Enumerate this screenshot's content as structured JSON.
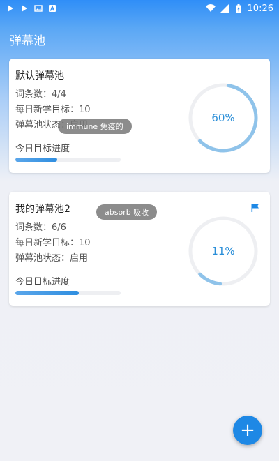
{
  "statusbar": {
    "time": "10:26",
    "left_icons": [
      "youku-icon",
      "youku-icon",
      "image-icon",
      "a-icon"
    ],
    "right_icons": [
      "wifi-icon",
      "signal-icon",
      "battery-icon"
    ]
  },
  "app": {
    "title": "弹幕池"
  },
  "cards": [
    {
      "title": "默认弹幕池",
      "word_count": "词条数：4/4",
      "daily_goal": "每日新学目标：10",
      "status": "弹幕池状态：启用",
      "progress_label": "今日目标进度",
      "progress_fraction": 0.4,
      "ring_percent": 60,
      "ring_label": "60%",
      "flagged": false
    },
    {
      "title": "我的弹幕池2",
      "word_count": "词条数：6/6",
      "daily_goal": "每日新学目标：10",
      "status": "弹幕池状态：启用",
      "progress_label": "今日目标进度",
      "progress_fraction": 0.6,
      "ring_percent": 11,
      "ring_label": "11%",
      "flagged": true
    }
  ],
  "toasts": [
    {
      "text": "immune  免疫的"
    },
    {
      "text": "absorb  吸收"
    }
  ],
  "fab": {
    "label": "+"
  },
  "colors": {
    "accent": "#1e88e5",
    "ring_track": "#eeeff2",
    "ring_fill": "#8fc3ea",
    "ring_text": "#2a8ed8"
  }
}
